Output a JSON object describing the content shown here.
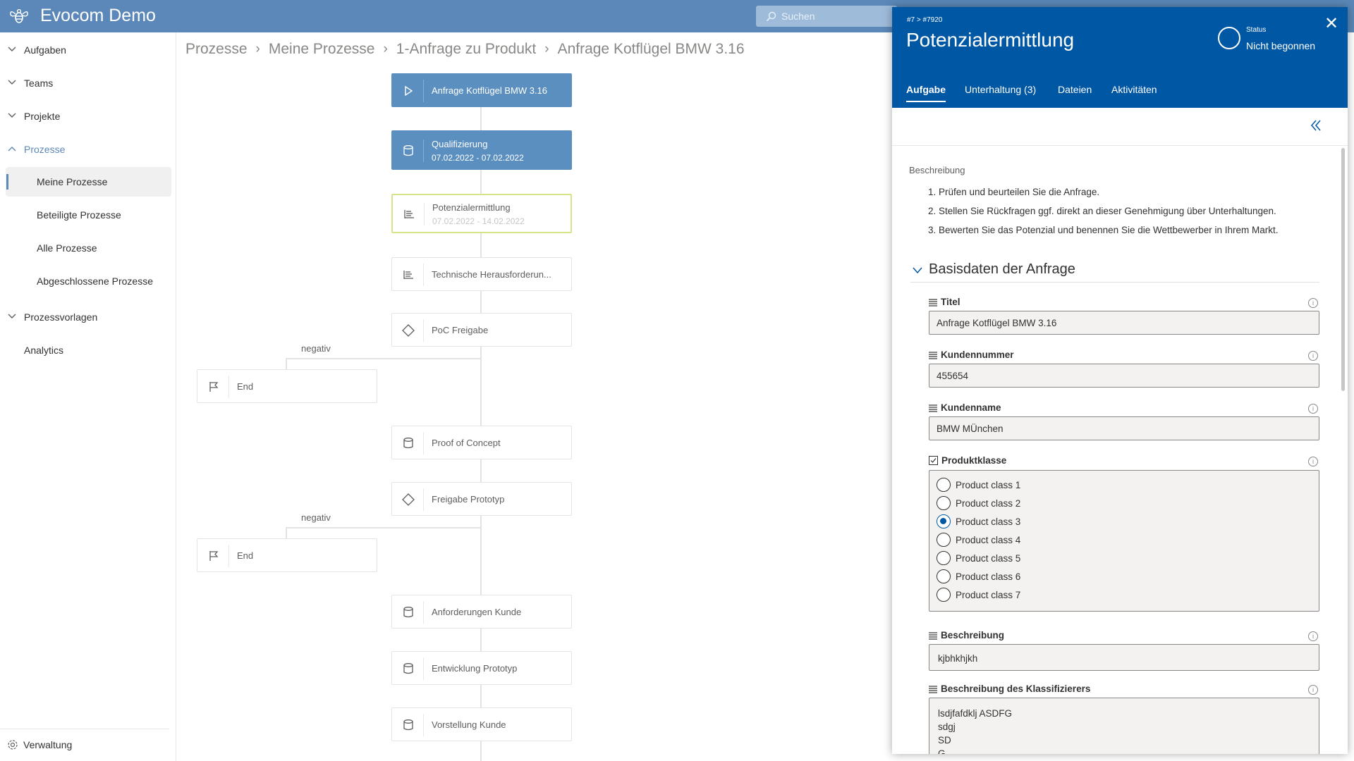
{
  "app": {
    "title": "Evocom Demo",
    "search_placeholder": "Suchen"
  },
  "sidebar": {
    "items": [
      {
        "label": "Aufgaben"
      },
      {
        "label": "Teams"
      },
      {
        "label": "Projekte"
      },
      {
        "label": "Prozesse"
      },
      {
        "label": "Meine Prozesse"
      },
      {
        "label": "Beteiligte Prozesse"
      },
      {
        "label": "Alle Prozesse"
      },
      {
        "label": "Abgeschlossene Prozesse"
      },
      {
        "label": "Prozessvorlagen"
      },
      {
        "label": "Analytics"
      }
    ],
    "footer": "Verwaltung",
    "accent": "#5b88b8"
  },
  "breadcrumb": [
    "Prozesse",
    "Meine Prozesse",
    "1-Anfrage zu Produkt",
    "Anfrage Kotflügel BMW 3.16"
  ],
  "flow": {
    "nodes": [
      {
        "label": "Anfrage Kotflügel BMW 3.16",
        "icon": "play-icon",
        "state": "done"
      },
      {
        "label": "Qualifizierung",
        "date": "07.02.2022 - 07.02.2022",
        "icon": "database-icon",
        "state": "done"
      },
      {
        "label": "Potenzialermittlung",
        "date": "07.02.2022 - 14.02.2022",
        "icon": "list-icon",
        "state": "active"
      },
      {
        "label": "Technische Herausforderun...",
        "icon": "list-icon"
      },
      {
        "label": "PoC Freigabe",
        "icon": "diamond-icon"
      },
      {
        "label": "End",
        "icon": "flag-icon"
      },
      {
        "label": "Proof of Concept",
        "icon": "database-icon"
      },
      {
        "label": "Freigabe Prototyp",
        "icon": "diamond-icon"
      },
      {
        "label": "End",
        "icon": "flag-icon"
      },
      {
        "label": "Anforderungen Kunde",
        "icon": "database-icon"
      },
      {
        "label": "Entwicklung Prototyp",
        "icon": "database-icon"
      },
      {
        "label": "Vorstellung Kunde",
        "icon": "database-icon"
      }
    ],
    "negative_1": "negativ",
    "negative_2": "negativ"
  },
  "panel": {
    "crumb": "#7 >  #7920",
    "title": "Potenzialermittlung",
    "status_label": "Status",
    "status_value": "Nicht begonnen",
    "header_color": "#0057a3",
    "tabs": [
      "Aufgabe",
      "Unterhaltung (3)",
      "Dateien",
      "Aktivitäten"
    ],
    "description_title": "Beschreibung",
    "description_items": [
      "Prüfen und beurteilen Sie die Anfrage.",
      "Stellen Sie Rückfragen ggf. direkt an dieser Genehmigung über Unterhaltungen.",
      "Bewerten Sie das Potenzial und benennen Sie die Wettbewerber in Ihrem Markt."
    ],
    "section_title": "Basisdaten der Anfrage",
    "fields": {
      "titel": {
        "label": "Titel",
        "value": "Anfrage Kotflügel BMW 3.16"
      },
      "kundennummer": {
        "label": "Kundennummer",
        "value": "455654"
      },
      "kundenname": {
        "label": "Kundenname",
        "value": "BMW MÜnchen"
      },
      "produktklasse": {
        "label": "Produktklasse",
        "options": [
          "Product class 1",
          "Product class 2",
          "Product class 3",
          "Product class 4",
          "Product class 5",
          "Product class 6",
          "Product class 7"
        ],
        "selected": "Product class 3"
      },
      "beschreibung": {
        "label": "Beschreibung",
        "value": "kjbhkhjkh"
      },
      "klassifizierer": {
        "label": "Beschreibung des Klassifizierers",
        "lines": [
          "lsdjfafdklj ASDFG",
          "sdgj",
          "SD",
          "G"
        ]
      }
    }
  }
}
